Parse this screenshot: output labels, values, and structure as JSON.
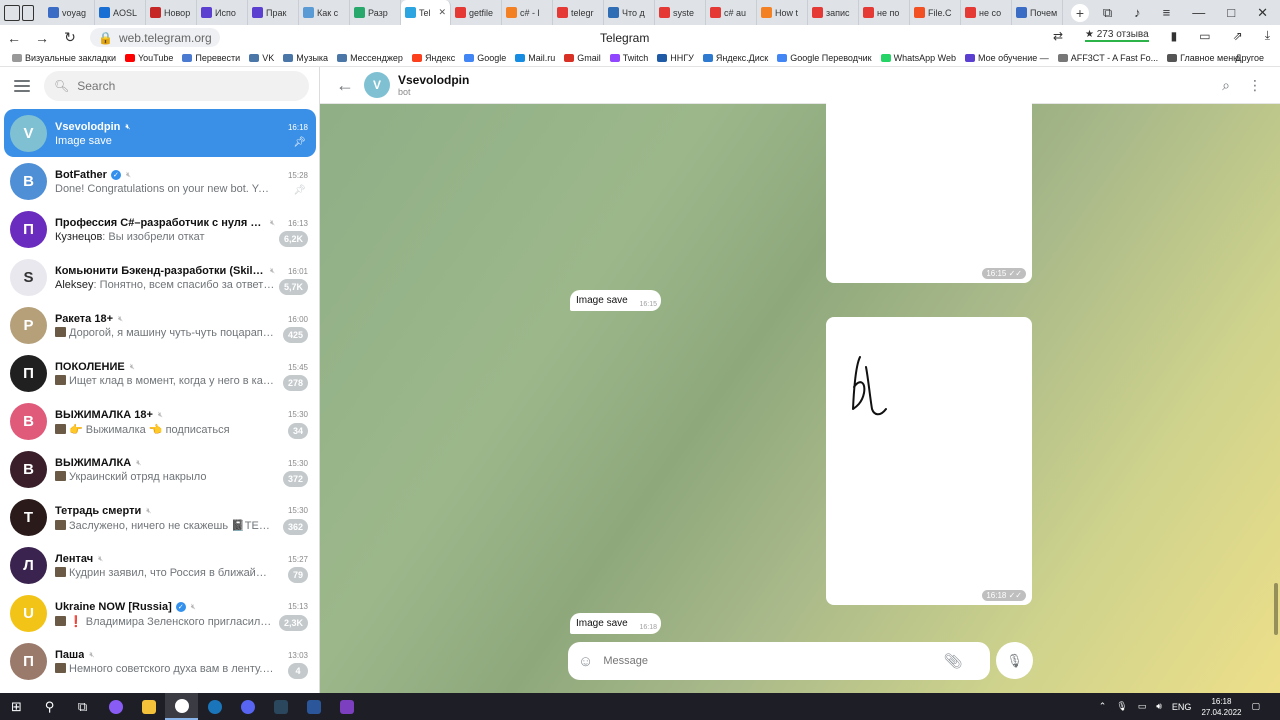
{
  "browser": {
    "tabs": [
      {
        "label": "voyag",
        "color": "#3b6cc5"
      },
      {
        "label": "AOSL",
        "color": "#1a6fd4"
      },
      {
        "label": "Новор",
        "color": "#c62828"
      },
      {
        "label": "Испо",
        "color": "#5b3fd1"
      },
      {
        "label": "Прак",
        "color": "#5b3fd1"
      },
      {
        "label": "Как с",
        "color": "#5a9bd5"
      },
      {
        "label": "Разр",
        "color": "#28a86b"
      },
      {
        "label": "Tel",
        "color": "#2ca5e0",
        "active": true
      },
      {
        "label": "getfile",
        "color": "#e53935"
      },
      {
        "label": "c# - l",
        "color": "#f48024"
      },
      {
        "label": "telegr",
        "color": "#e53935"
      },
      {
        "label": "Что д",
        "color": "#2f6db4"
      },
      {
        "label": "syste",
        "color": "#e53935"
      },
      {
        "label": "c# au",
        "color": "#e53935"
      },
      {
        "label": "How t",
        "color": "#f48024"
      },
      {
        "label": "запис",
        "color": "#e53935"
      },
      {
        "label": "не по",
        "color": "#e53935"
      },
      {
        "label": "File.C",
        "color": "#f25022"
      },
      {
        "label": "не со",
        "color": "#e53935"
      },
      {
        "label": "Почем",
        "color": "#3b6cc5"
      }
    ],
    "url": "web.telegram.org",
    "page_title": "Telegram",
    "rating": "★ 273 отзыва",
    "bookmarks": [
      {
        "label": "Визуальные закладки",
        "color": "#999999"
      },
      {
        "label": "YouTube",
        "color": "#ff0000"
      },
      {
        "label": "Перевести",
        "color": "#4a7bd1"
      },
      {
        "label": "VK",
        "color": "#4a76a8"
      },
      {
        "label": "Музыка",
        "color": "#4a76a8"
      },
      {
        "label": "Мессенджер",
        "color": "#4a76a8"
      },
      {
        "label": "Яндекс",
        "color": "#fc3f1d"
      },
      {
        "label": "Google",
        "color": "#4285f4"
      },
      {
        "label": "Mail.ru",
        "color": "#168de2"
      },
      {
        "label": "Gmail",
        "color": "#d93025"
      },
      {
        "label": "Twitch",
        "color": "#9146ff"
      },
      {
        "label": "ННГУ",
        "color": "#1f5aa6"
      },
      {
        "label": "Яндекс.Диск",
        "color": "#2e7ad1"
      },
      {
        "label": "Google Переводчик",
        "color": "#4285f4"
      },
      {
        "label": "WhatsApp Web",
        "color": "#25d366"
      },
      {
        "label": "Мое обучение —",
        "color": "#5b3fd1"
      },
      {
        "label": "AFF3CT - A Fast Fo...",
        "color": "#777777"
      },
      {
        "label": "Главное меню",
        "color": "#555555"
      }
    ],
    "other_bookmarks": "Другое"
  },
  "sidebar": {
    "search_placeholder": "Search",
    "chats": [
      {
        "name": "Vsevolodpin",
        "avatar_letter": "V",
        "avatar_color": "#7fc1d3",
        "time": "16:18",
        "preview": "Image save",
        "pinned": true,
        "muted": true,
        "selected": true
      },
      {
        "name": "BotFather",
        "avatar_letter": "B",
        "avatar_color": "#4f8fd6",
        "time": "15:28",
        "preview": "Done! Congratulations on your new bot. You will ...",
        "pinned": true,
        "muted": true,
        "verified": true
      },
      {
        "name": "Профессия C#–разработчик с нуля до ...",
        "avatar_letter": "П",
        "avatar_color": "#6a2bbf",
        "time": "16:13",
        "sender": "Кузнецов",
        "preview": "Вы изобрели откат",
        "unread": "6,2K",
        "muted": true
      },
      {
        "name": "Комьюнити Бэкенд-разработки (Skillb...",
        "avatar_letter": "S",
        "avatar_color": "#e8e8ee",
        "time": "16:01",
        "sender": "Aleksey",
        "preview": "Понятно, всем спасибо за ответы, ...",
        "unread": "5,7K",
        "muted": true
      },
      {
        "name": "Ракета 18+",
        "avatar_letter": "Р",
        "avatar_color": "#b5a07a",
        "time": "16:00",
        "preview": "Дорогой, я машину чуть-чуть поцарапала",
        "unread": "425",
        "muted": true,
        "thumb": true
      },
      {
        "name": "ПОКОЛЕНИЕ",
        "avatar_letter": "П",
        "avatar_color": "#202020",
        "time": "15:45",
        "preview": "Ищет клад в момент, когда у него в кар...",
        "unread": "278",
        "muted": true,
        "thumb": true
      },
      {
        "name": "ВЫЖИМАЛКА 18+",
        "avatar_letter": "В",
        "avatar_color": "#e05a7a",
        "time": "15:30",
        "preview": "👉 Выжималка 👈 подписаться",
        "unread": "34",
        "muted": true,
        "thumb": true
      },
      {
        "name": "ВЫЖИМАЛКА",
        "avatar_letter": "В",
        "avatar_color": "#3a1f2a",
        "time": "15:30",
        "preview": "Украинский отряд накрыло",
        "unread": "372",
        "muted": true,
        "thumb": true
      },
      {
        "name": "Тетрадь смерти",
        "avatar_letter": "Т",
        "avatar_color": "#2a1a1a",
        "time": "15:30",
        "preview": "Заслужено, ничего не скажешь 📓ТЕТРА...",
        "unread": "362",
        "muted": true,
        "thumb": true
      },
      {
        "name": "Лентач",
        "avatar_letter": "Л",
        "avatar_color": "#3b2350",
        "time": "15:27",
        "preview": "Кудрин заявил, что Россия в ближайшие ...",
        "unread": "79",
        "muted": true,
        "thumb": true
      },
      {
        "name": "Ukraine NOW [Russia]",
        "avatar_letter": "U",
        "avatar_color": "#f2c417",
        "time": "15:13",
        "preview": "❗ Владимира Зеленского пригласили н...",
        "unread": "2,3K",
        "muted": true,
        "verified": true,
        "thumb": true
      },
      {
        "name": "Паша",
        "avatar_letter": "П",
        "avatar_color": "#9a7a6a",
        "time": "13:03",
        "preview": "Немного советского духа вам в ленту. В З...",
        "unread": "4",
        "muted": true,
        "thumb": true
      }
    ]
  },
  "chat": {
    "title": "Vsevolodpin",
    "subtitle": "bot",
    "avatar_letter": "V",
    "messages": [
      {
        "kind": "image",
        "time": "16:15"
      },
      {
        "kind": "text",
        "text": "Image save",
        "time": "16:15"
      },
      {
        "kind": "image",
        "time": "16:18"
      },
      {
        "kind": "text",
        "text": "Image save",
        "time": "16:18"
      }
    ],
    "composer_placeholder": "Message"
  },
  "taskbar": {
    "language": "ENG",
    "time": "16:18",
    "date": "27.04.2022"
  }
}
